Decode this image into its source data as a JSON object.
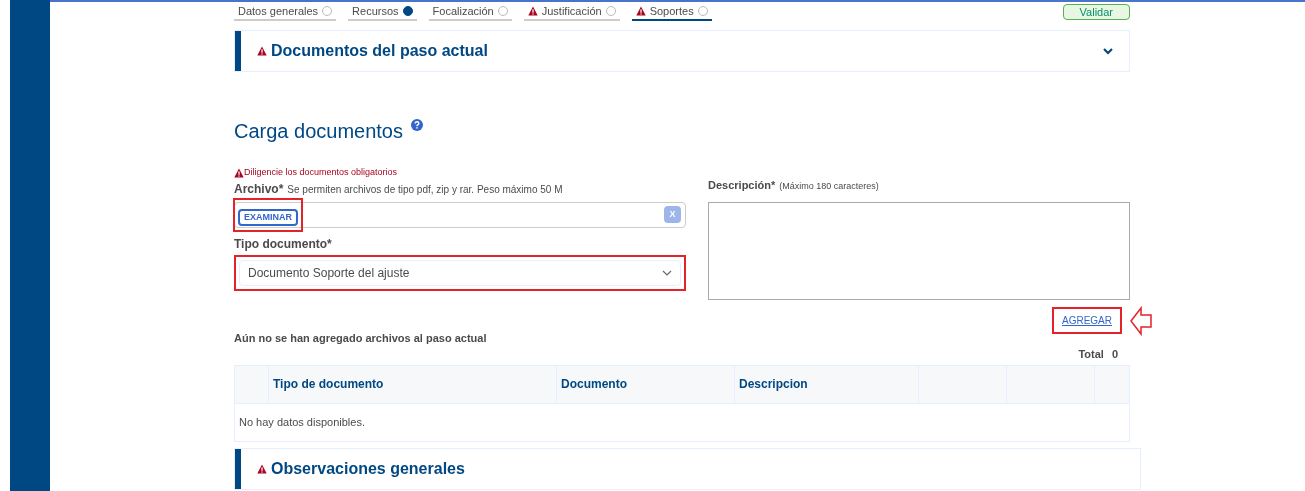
{
  "steps": [
    {
      "label": "Datos generales",
      "selected": false,
      "done": false,
      "warning": false
    },
    {
      "label": "Recursos",
      "selected": false,
      "done": true,
      "warning": false
    },
    {
      "label": "Focalización",
      "selected": false,
      "done": false,
      "warning": false
    },
    {
      "label": "Justificación",
      "selected": false,
      "done": false,
      "warning": true
    },
    {
      "label": "Soportes",
      "selected": true,
      "done": false,
      "warning": true
    }
  ],
  "validate_button": "Validar",
  "documents_panel": {
    "title": "Documentos del paso actual",
    "warning": true,
    "expanded": false
  },
  "upload": {
    "title": "Carga documentos",
    "alert": "Diligencie los documentos obligatorios",
    "file_label": "Archivo*",
    "file_hint": "Se permiten archivos de tipo pdf, zip y rar. Peso máximo 50 M",
    "browse_button": {
      "label": "EXAMINAR",
      "highlighted": true
    },
    "clear_button": "X",
    "type_label": "Tipo documento*",
    "type_value": "Documento Soporte del ajuste",
    "type_highlighted": true,
    "description_label": "Descripción*",
    "description_hint": "(Máximo 180 caracteres)",
    "add_link": {
      "label": "AGREGAR",
      "highlighted": true
    }
  },
  "empty_message": "Aún no se han agregado archivos al paso actual",
  "total_label": "Total",
  "total_value": "0",
  "table": {
    "columns": [
      "Tipo de documento",
      "Documento",
      "Descripcion"
    ],
    "empty": "No hay datos disponibles."
  },
  "observations_panel": {
    "title": "Observaciones generales",
    "warning": true
  }
}
